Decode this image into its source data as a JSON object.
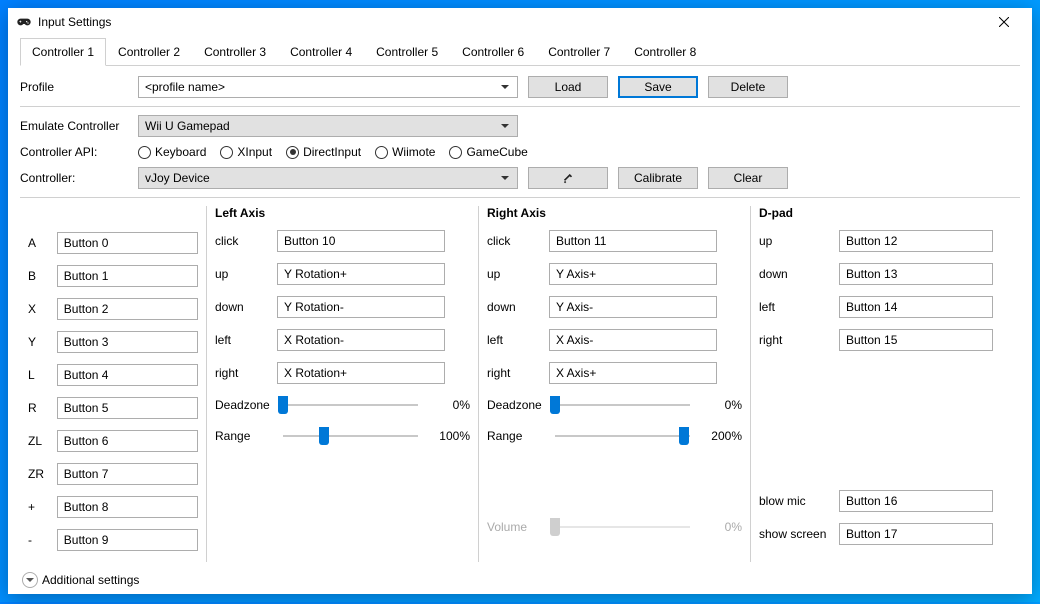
{
  "window_title": "Input Settings",
  "tabs": [
    "Controller 1",
    "Controller 2",
    "Controller 3",
    "Controller 4",
    "Controller 5",
    "Controller 6",
    "Controller 7",
    "Controller 8"
  ],
  "active_tab": 0,
  "profile": {
    "label": "Profile",
    "value": "<profile name>",
    "buttons": {
      "load": "Load",
      "save": "Save",
      "delete": "Delete"
    }
  },
  "emulate": {
    "label": "Emulate Controller",
    "value": "Wii U Gamepad"
  },
  "api": {
    "label": "Controller API:",
    "options": [
      "Keyboard",
      "XInput",
      "DirectInput",
      "Wiimote",
      "GameCube"
    ],
    "selected": "DirectInput"
  },
  "controller": {
    "label": "Controller:",
    "value": "vJoy Device",
    "calibrate": "Calibrate",
    "clear": "Clear"
  },
  "buttons_col": [
    {
      "label": "A",
      "value": "Button 0"
    },
    {
      "label": "B",
      "value": "Button 1"
    },
    {
      "label": "X",
      "value": "Button 2"
    },
    {
      "label": "Y",
      "value": "Button 3"
    },
    {
      "label": "L",
      "value": "Button 4"
    },
    {
      "label": "R",
      "value": "Button 5"
    },
    {
      "label": "ZL",
      "value": "Button 6"
    },
    {
      "label": "ZR",
      "value": "Button 7"
    },
    {
      "label": "+",
      "value": "Button 8"
    },
    {
      "label": "-",
      "value": "Button 9"
    }
  ],
  "left_axis": {
    "title": "Left Axis",
    "rows": [
      {
        "label": "click",
        "value": "Button 10"
      },
      {
        "label": "up",
        "value": "Y Rotation+"
      },
      {
        "label": "down",
        "value": "Y Rotation-"
      },
      {
        "label": "left",
        "value": "X Rotation-"
      },
      {
        "label": "right",
        "value": "X Rotation+"
      }
    ],
    "deadzone": {
      "label": "Deadzone",
      "percent": 0,
      "display": "0%"
    },
    "range": {
      "label": "Range",
      "percent": 30,
      "display": "100%"
    }
  },
  "right_axis": {
    "title": "Right Axis",
    "rows": [
      {
        "label": "click",
        "value": "Button 11"
      },
      {
        "label": "up",
        "value": "Y Axis+"
      },
      {
        "label": "down",
        "value": "Y Axis-"
      },
      {
        "label": "left",
        "value": "X Axis-"
      },
      {
        "label": "right",
        "value": "X Axis+"
      }
    ],
    "deadzone": {
      "label": "Deadzone",
      "percent": 0,
      "display": "0%"
    },
    "range": {
      "label": "Range",
      "percent": 95,
      "display": "200%"
    },
    "volume": {
      "label": "Volume",
      "percent": 0,
      "display": "0%"
    }
  },
  "dpad": {
    "title": "D-pad",
    "rows": [
      {
        "label": "up",
        "value": "Button 12"
      },
      {
        "label": "down",
        "value": "Button 13"
      },
      {
        "label": "left",
        "value": "Button 14"
      },
      {
        "label": "right",
        "value": "Button 15"
      }
    ],
    "extra": [
      {
        "label": "blow mic",
        "value": "Button 16"
      },
      {
        "label": "show screen",
        "value": "Button 17"
      }
    ]
  },
  "additional_label": "Additional settings"
}
